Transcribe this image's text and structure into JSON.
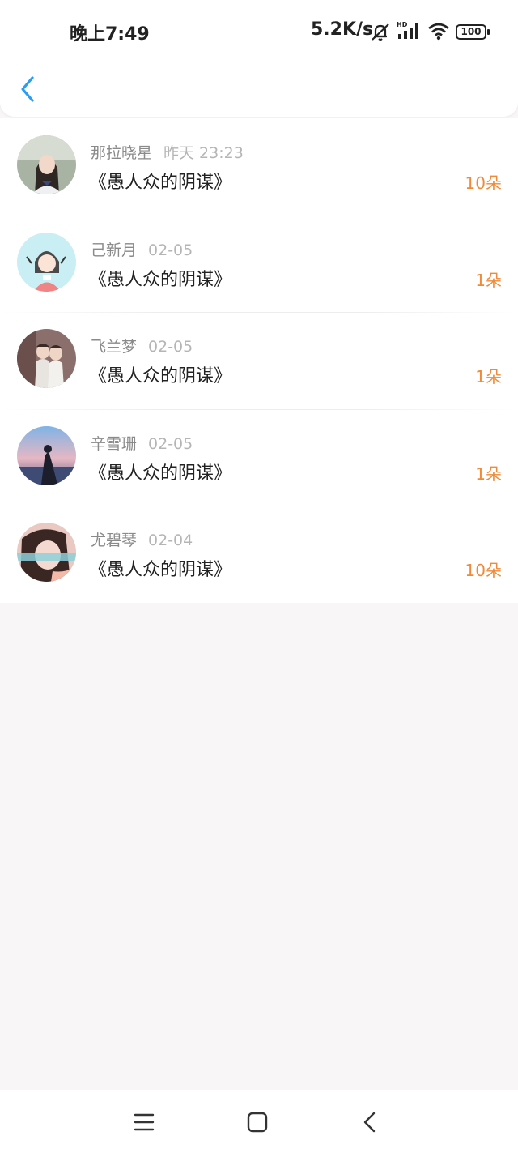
{
  "status_bar": {
    "time": "晚上7:49",
    "net_speed": "5.2K/s",
    "battery": "100"
  },
  "colors": {
    "accent": "#2a9df4",
    "gift": "#f08a37",
    "background": "#f8f6f7"
  },
  "header": {
    "back_icon": "chevron-left-icon"
  },
  "items": [
    {
      "name": "那拉晓星",
      "date": "昨天 23:23",
      "title": "《愚人众的阴谋》",
      "gift": "10朵"
    },
    {
      "name": "己新月",
      "date": "02-05",
      "title": "《愚人众的阴谋》",
      "gift": "1朵"
    },
    {
      "name": "飞兰梦",
      "date": "02-05",
      "title": "《愚人众的阴谋》",
      "gift": "1朵"
    },
    {
      "name": "辛雪珊",
      "date": "02-05",
      "title": "《愚人众的阴谋》",
      "gift": "1朵"
    },
    {
      "name": "尤碧琴",
      "date": "02-04",
      "title": "《愚人众的阴谋》",
      "gift": "10朵"
    }
  ],
  "nav_bar": {
    "menu_icon": "menu-icon",
    "home_icon": "home-square-icon",
    "back_icon": "back-triangle-icon"
  }
}
